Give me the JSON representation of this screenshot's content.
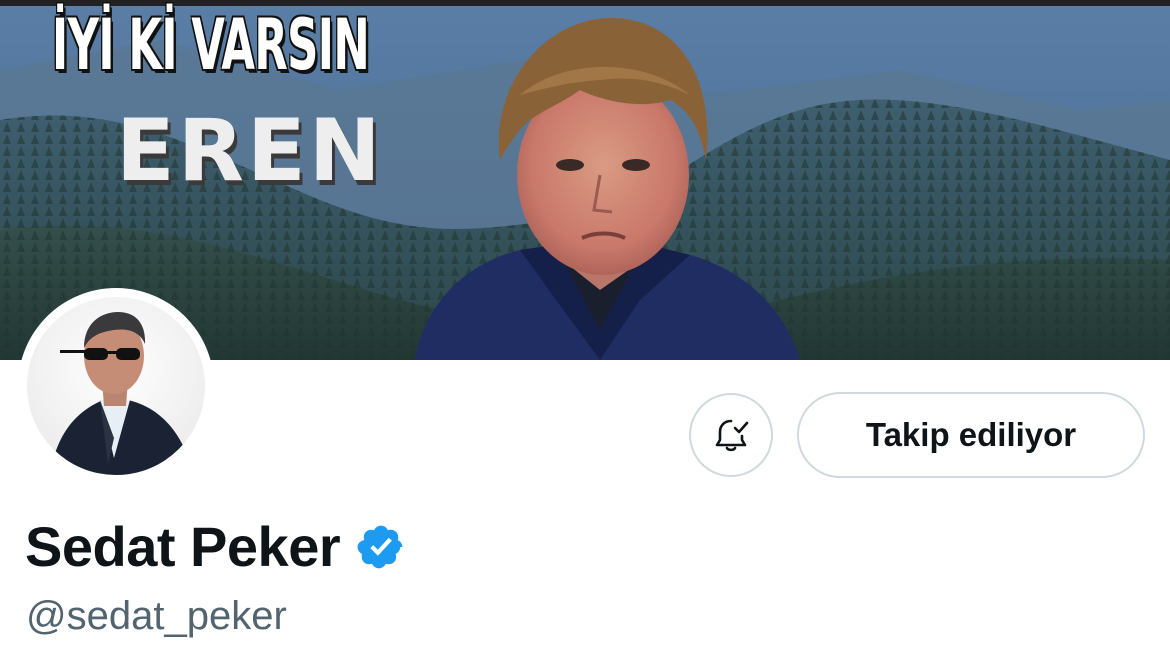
{
  "banner": {
    "headline": "İYİ Kİ VARSIN",
    "name": "EREN"
  },
  "profile": {
    "display_name": "Sedat Peker",
    "handle": "@sedat_peker",
    "verified": true,
    "verified_badge_color": "#1d9bf0"
  },
  "actions": {
    "notification_icon": "bell-check-icon",
    "follow_label": "Takip ediliyor"
  },
  "colors": {
    "text_primary": "#0f1419",
    "text_secondary": "#536471",
    "button_border": "#cfd9de"
  }
}
